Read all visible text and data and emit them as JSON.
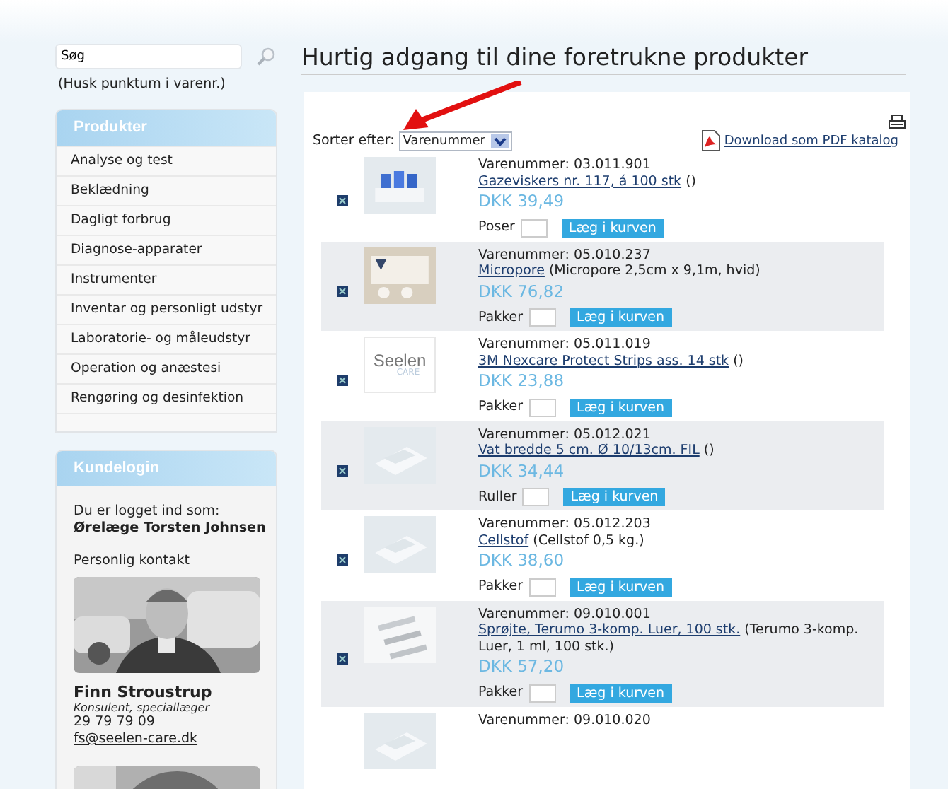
{
  "search": {
    "value": "Søg",
    "hint": "(Husk punktum i varenr.)"
  },
  "products_menu": {
    "title": "Produkter",
    "items": [
      "Analyse og test",
      "Beklædning",
      "Dagligt forbrug",
      "Diagnose-apparater",
      "Instrumenter",
      "Inventar og personligt udstyr",
      "Laboratorie- og måleudstyr",
      "Operation og anæstesi",
      "Rengøring og desinfektion"
    ]
  },
  "customer_login": {
    "title": "Kundelogin",
    "logged_in_label": "Du er logget ind som:",
    "user_name": "Ørelæge Torsten Johnsen",
    "contact_heading": "Personlig kontakt",
    "contact": {
      "name": "Finn Stroustrup",
      "role": "Konsulent, speciallæger",
      "phone": "29 79 79 09",
      "email": "fs@seelen-care.dk"
    }
  },
  "main": {
    "title": "Hurtig adgang til dine foretrukne produkter",
    "sort_label": "Sorter efter:",
    "sort_value": "Varenummer",
    "pdf_link": "Download som PDF katalog"
  },
  "products": [
    {
      "number": "Varenummer: 03.011.901",
      "name": "Gazeviskers nr. 117, á 100 stk",
      "details": "()",
      "price": "DKK 39,49",
      "unit": "Poser",
      "button": "Læg i kurven"
    },
    {
      "number": "Varenummer: 05.010.237",
      "name": "Micropore",
      "details": "(Micropore 2,5cm x 9,1m, hvid)",
      "price": "DKK 76,82",
      "unit": "Pakker",
      "button": "Læg i kurven"
    },
    {
      "number": "Varenummer: 05.011.019",
      "name": "3M Nexcare Protect Strips ass. 14 stk",
      "details": "()",
      "price": "DKK 23,88",
      "unit": "Pakker",
      "button": "Læg i kurven",
      "image": {
        "kind": "logo",
        "text": "Seelen",
        "subtext": "CARE"
      }
    },
    {
      "number": "Varenummer: 05.012.021",
      "name": "Vat bredde 5 cm. Ø 10/13cm. FIL",
      "details": "()",
      "price": "DKK 34,44",
      "unit": "Ruller",
      "button": "Læg i kurven"
    },
    {
      "number": "Varenummer: 05.012.203",
      "name": "Cellstof",
      "details": "(Cellstof 0,5 kg.)",
      "price": "DKK 38,60",
      "unit": "Pakker",
      "button": "Læg i kurven"
    },
    {
      "number": "Varenummer: 09.010.001",
      "name": "Sprøjte, Terumo 3-komp. Luer, 100 stk.",
      "details": "(Terumo 3-komp. Luer, 1 ml, 100 stk.)",
      "price": "DKK 57,20",
      "unit": "Pakker",
      "button": "Læg i kurven"
    },
    {
      "number": "Varenummer: 09.010.020"
    }
  ]
}
